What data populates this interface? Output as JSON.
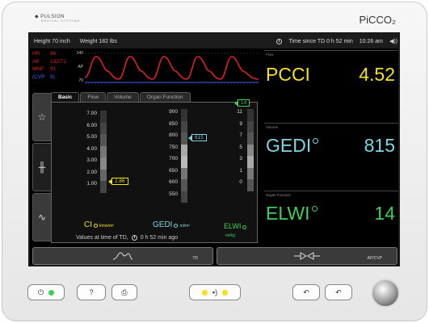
{
  "brand": {
    "name": "PULSION",
    "sub": "MEDICAL SYSTEMS",
    "model": "PiCCO₂"
  },
  "topbar": {
    "height": "Height  70 inch",
    "weight": "Weight 182 lbs",
    "since_td": "Time since TD  0 h 52 min",
    "time": "10:26 am",
    "speaker_icon": "speaker-icon"
  },
  "vitals": [
    {
      "key": "HR",
      "value": "86"
    },
    {
      "key": "AP",
      "value": "132/71"
    },
    {
      "key": "MAP",
      "value": "91"
    },
    {
      "key": "(CVP",
      "value": "9)"
    }
  ],
  "wave_scale": {
    "top": "140",
    "mid": "AP",
    "bottom": "70"
  },
  "colors": {
    "yellow": "#f5e11a",
    "cyan": "#7fd6de",
    "green": "#3ecf5a",
    "red": "#e02020",
    "blue": "#4060ff"
  },
  "tabs": [
    "Basic",
    "Flow",
    "Volume",
    "Organ Function"
  ],
  "left_tabs": [
    "star-icon",
    "bars-icon",
    "trend-icon"
  ],
  "panel": {
    "ci": {
      "ticks": [
        "7.00",
        "6.00",
        "5.00",
        "4.00",
        "3.00",
        "2.00",
        "1.00"
      ],
      "marker": "2.86",
      "label": "CI",
      "unit": "l/min/m²"
    },
    "gedi": {
      "ticks": [
        "900",
        "850",
        "800",
        "750",
        "700",
        "650",
        "600",
        "550"
      ],
      "marker": "815",
      "label": "GEDI",
      "unit": "ml/m²"
    },
    "elwi": {
      "ticks": [
        "11",
        "9",
        "7",
        "5",
        "3",
        "1",
        "0"
      ],
      "marker": "14",
      "label": "ELWI",
      "unit": "ml/kg"
    },
    "footer": "Values at time of TD,",
    "footer_time": "0 h 52 min ago"
  },
  "buttons": {
    "td": "TD",
    "apcvp": "AP/CVP"
  },
  "right": {
    "flow": {
      "section": "Flow",
      "name": "PCCI",
      "value": "4.52"
    },
    "volume": {
      "section": "Volume",
      "name": "GEDI",
      "value": "815"
    },
    "organ": {
      "section": "Organ Function",
      "name": "ELWI",
      "value": "14"
    }
  },
  "hardware": {
    "help": "?",
    "back": "↶",
    "undo": "↶"
  }
}
